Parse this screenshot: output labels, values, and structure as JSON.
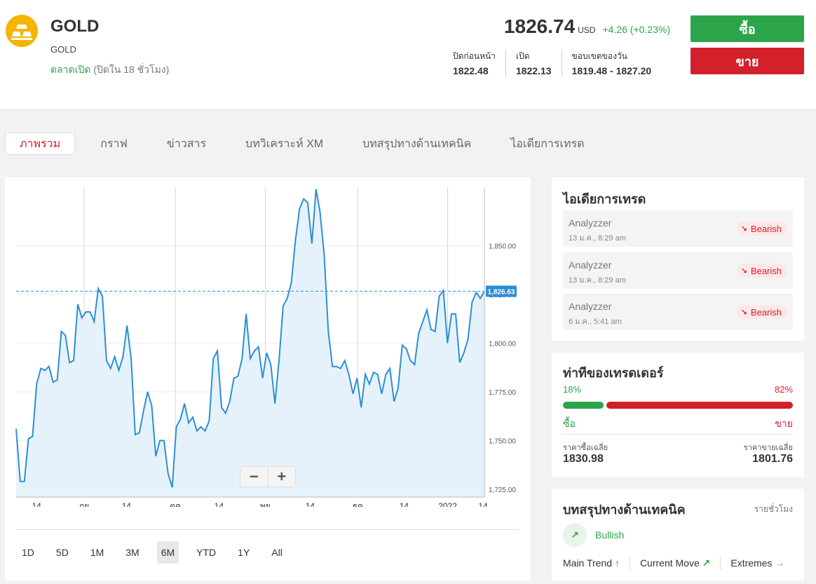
{
  "header": {
    "symbol": "GOLD",
    "subtitle": "GOLD",
    "market_status": "ตลาดเปิด",
    "market_close": "(ปิดใน 18 ชั่วโมง)",
    "price": "1826.74",
    "currency": "USD",
    "change": "+4.26 (+0.23%)",
    "stats": [
      {
        "label": "ปิดก่อนหน้า",
        "value": "1822.48"
      },
      {
        "label": "เปิด",
        "value": "1822.13"
      },
      {
        "label": "ขอบเขตของวัน",
        "value": "1819.48 - 1827.20"
      }
    ],
    "buy_label": "ซื้อ",
    "sell_label": "ขาย"
  },
  "tabs": [
    "ภาพรวม",
    "กราฟ",
    "ข่าวสาร",
    "บทวิเคราะห์ XM",
    "บทสรุปทางด้านเทคนิค",
    "ไอเดียการเทรด"
  ],
  "ranges": [
    "1D",
    "5D",
    "1M",
    "3M",
    "6M",
    "YTD",
    "1Y",
    "All"
  ],
  "colors": {
    "green": "#2ca54a",
    "red": "#d3202a",
    "line": "#2b8fd8",
    "area": "#e6f2fb"
  },
  "chart_data": {
    "type": "area",
    "ylim": [
      1721,
      1880
    ],
    "y_ticks": [
      "1,850.00",
      "1,825.00",
      "1,800.00",
      "1,775.00",
      "1,750.00",
      "1,725.00"
    ],
    "y_tick_values": [
      1850,
      1825,
      1800,
      1775,
      1750,
      1725
    ],
    "x_tick_labels": [
      "14",
      "กย",
      "14",
      "ตค",
      "14",
      "พย",
      "14",
      "ธค",
      "14",
      "2022",
      "14"
    ],
    "current_price_label": "1,826.63",
    "current_price": 1826.63,
    "values": [
      1756,
      1729,
      1729,
      1751,
      1752,
      1779,
      1787,
      1786,
      1788,
      1780,
      1781,
      1806,
      1804,
      1790,
      1791,
      1820,
      1813,
      1816,
      1816,
      1811,
      1828,
      1824,
      1791,
      1787,
      1793,
      1786,
      1793,
      1809,
      1792,
      1753,
      1754,
      1765,
      1775,
      1768,
      1742,
      1750,
      1750,
      1733,
      1726,
      1757,
      1761,
      1769,
      1759,
      1762,
      1755,
      1757,
      1755,
      1760,
      1792,
      1796,
      1767,
      1764,
      1770,
      1782,
      1783,
      1792,
      1815,
      1792,
      1796,
      1798,
      1782,
      1795,
      1789,
      1769,
      1791,
      1819,
      1823,
      1831,
      1853,
      1869,
      1874,
      1872,
      1851,
      1879,
      1867,
      1845,
      1806,
      1788,
      1788,
      1787,
      1791,
      1784,
      1774,
      1782,
      1767,
      1784,
      1779,
      1785,
      1784,
      1774,
      1784,
      1787,
      1770,
      1777,
      1799,
      1797,
      1791,
      1789,
      1805,
      1811,
      1817,
      1807,
      1806,
      1824,
      1827,
      1800,
      1815,
      1815,
      1790,
      1795,
      1802,
      1821,
      1826,
      1823,
      1826.6
    ]
  },
  "trade_ideas": {
    "title": "ไอเดียการเทรด",
    "items": [
      {
        "name": "Analyzzer",
        "time": "13 ม.ค., 8:29 am",
        "signal": "Bearish"
      },
      {
        "name": "Analyzzer",
        "time": "13 ม.ค., 8:29 am",
        "signal": "Bearish"
      },
      {
        "name": "Analyzzer",
        "time": "6 ม.ค., 5:41 am",
        "signal": "Bearish"
      }
    ]
  },
  "sentiment": {
    "title": "ท่าทีของเทรดเดอร์",
    "buy_pct": "18%",
    "sell_pct": "82%",
    "buy_fraction": 0.18,
    "buy_label": "ซื้อ",
    "sell_label": "ขาย",
    "avg_buy_label": "ราคาซื้อเฉลี่ย",
    "avg_buy": "1830.98",
    "avg_sell_label": "ราคาขายเฉลี่ย",
    "avg_sell": "1801.76"
  },
  "technical": {
    "title": "บทสรุปทางด้านเทคนิค",
    "period": "รายชั่วโมง",
    "signal": "Bullish",
    "links": [
      "Main Trend",
      "Current Move",
      "Extremes"
    ]
  }
}
